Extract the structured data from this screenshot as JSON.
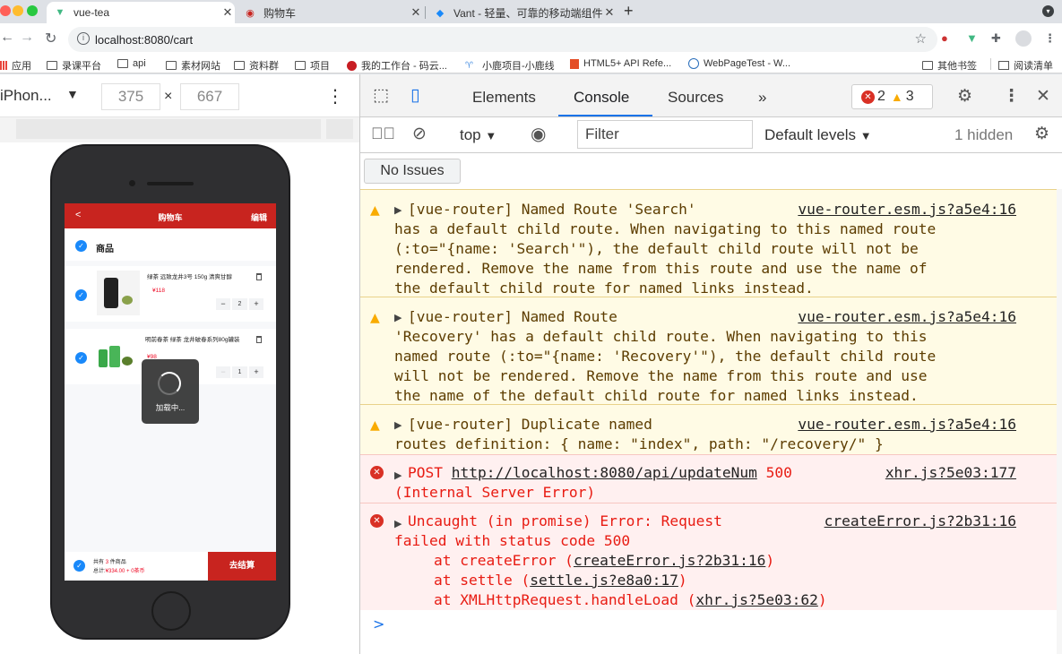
{
  "tabs": [
    {
      "title": "vue-tea",
      "favicon": "vue-logo-icon",
      "active": true
    },
    {
      "title": "购物车",
      "favicon": "tea-logo-icon",
      "active": false
    },
    {
      "title": "Vant - 轻量、可靠的移动端组件",
      "favicon": "vant-logo-icon",
      "active": false
    }
  ],
  "address": {
    "url": "localhost:8080/cart"
  },
  "bookmarks": [
    "应用",
    "录课平台",
    "api",
    "素材网站",
    "资料群",
    "项目",
    "我的工作台 - 码云...",
    "小鹿项目-小鹿线",
    "HTML5+ API Refe...",
    "WebPageTest - W...",
    "其他书签",
    "阅读清单"
  ],
  "device": {
    "name": "iPhon...",
    "width": "375",
    "height": "667",
    "times": "×"
  },
  "app": {
    "back": "<",
    "title": "购物车",
    "edit": "编辑",
    "check_mark": "✓",
    "shop_label": "商品",
    "items": [
      {
        "name": "绿茶 远致龙井3号 150g 清爽甘醇",
        "price": "¥118",
        "qty": "2"
      },
      {
        "name": "明前春茶 绿茶 龙井破春系列80g罐装",
        "price": "¥98",
        "qty": "1"
      }
    ],
    "minus": "−",
    "plus": "+",
    "loading": "加载中...",
    "summary_prefix": "共有",
    "summary_count": "3",
    "summary_suffix": "件商品",
    "total_prefix": "总计:",
    "total_value": "¥334.00 + 0茶币",
    "checkout": "去结算"
  },
  "devtools": {
    "tabs": [
      "Elements",
      "Console",
      "Sources",
      "»"
    ],
    "active_tab": "Console",
    "error_count": "2",
    "warning_count": "3",
    "context": "top",
    "filter_placeholder": "Filter",
    "levels": "Default levels",
    "hidden": "1 hidden",
    "no_issues": "No Issues"
  },
  "console": {
    "messages": [
      {
        "level": "warning",
        "source": "vue-router.esm.js?a5e4:16",
        "lines": [
          "[vue-router] Named Route 'Search'",
          "has a default child route. When navigating to this named route",
          "(:to=\"{name: 'Search'\"), the default child route will not be",
          "rendered. Remove the name from this route and use the name of",
          "the default child route for named links instead."
        ]
      },
      {
        "level": "warning",
        "source": "vue-router.esm.js?a5e4:16",
        "lines": [
          "[vue-router] Named Route",
          "'Recovery' has a default child route. When navigating to this",
          "named route (:to=\"{name: 'Recovery'\"), the default child route",
          "will not be rendered. Remove the name from this route and use",
          "the name of the default child route for named links instead."
        ]
      },
      {
        "level": "warning",
        "source": "vue-router.esm.js?a5e4:16",
        "lines": [
          "[vue-router] Duplicate named",
          "routes definition: { name: \"index\", path: \"/recovery/\" }"
        ]
      },
      {
        "level": "error",
        "method": "POST",
        "url": "http://localhost:8080/api/updateNum",
        "status": "500",
        "source": "xhr.js?5e03:177",
        "lines": [
          "(Internal Server Error)"
        ]
      },
      {
        "level": "error",
        "source": "createError.js?2b31:16",
        "lines": [
          "Uncaught (in promise) Error: Request",
          "failed with status code 500"
        ],
        "stack": [
          {
            "fn": "at createError (",
            "loc": "createError.js?2b31:16",
            "end": ")"
          },
          {
            "fn": "at settle (",
            "loc": "settle.js?e8a0:17",
            "end": ")"
          },
          {
            "fn": "at XMLHttpRequest.handleLoad (",
            "loc": "xhr.js?5e03:62",
            "end": ")"
          }
        ]
      }
    ],
    "prompt": ">"
  },
  "colors": {
    "accent_red": "#c8241f",
    "vant_blue": "#1989fa",
    "devtools_blue": "#1a73e8",
    "error_red": "#e81b12"
  }
}
